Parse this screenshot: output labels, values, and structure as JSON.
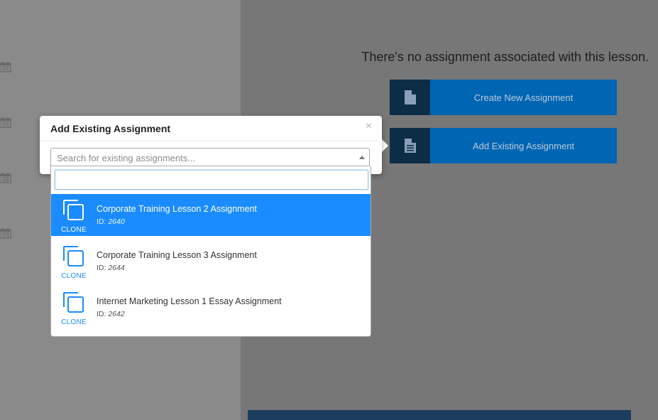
{
  "main": {
    "empty_message": "There's no assignment associated with this lesson.",
    "create_button_label": "Create New Assignment",
    "add_existing_button_label": "Add Existing Assignment"
  },
  "popover": {
    "title": "Add Existing Assignment",
    "close_symbol": "×",
    "select_placeholder": "Search for existing assignments...",
    "search_value": ""
  },
  "results": [
    {
      "clone_label": "CLONE",
      "title": "Corporate Training Lesson 2 Assignment",
      "id_prefix": "ID:",
      "id": "2640",
      "highlighted": true
    },
    {
      "clone_label": "CLONE",
      "title": "Corporate Training Lesson 3 Assignment",
      "id_prefix": "ID:",
      "id": "2644",
      "highlighted": false
    },
    {
      "clone_label": "CLONE",
      "title": "Internet Marketing Lesson 1 Essay Assignment",
      "id_prefix": "ID:",
      "id": "2642",
      "highlighted": false
    }
  ],
  "icons": {
    "calendar": "calendar-icon",
    "file": "file-icon",
    "file_text": "file-text-icon",
    "clone": "clone-icon"
  },
  "colors": {
    "accent": "#1a8cff",
    "button_blue": "#0066b3",
    "button_icon_dark": "#0d2d47"
  }
}
